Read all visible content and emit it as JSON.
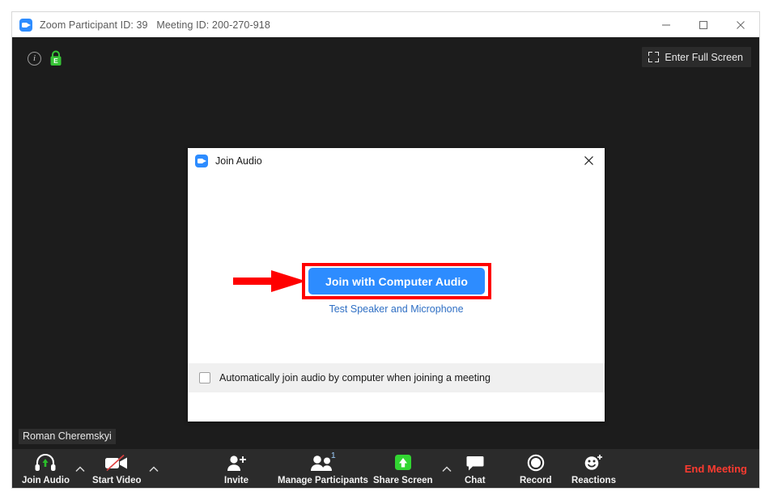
{
  "window": {
    "title": "Zoom Participant ID: 39   Meeting ID: 200-270-918",
    "logo_icon": "zoom-camera-icon",
    "controls": {
      "minimize": "minimize-icon",
      "maximize": "maximize-icon",
      "close": "close-icon"
    }
  },
  "stage": {
    "info_icon": "info-icon",
    "info_glyph": "i",
    "encryption_icon": "green-lock-encrypted-icon",
    "encryption_glyph": "E",
    "full_screen_label": "Enter Full Screen",
    "full_screen_icon": "expand-icon",
    "self_name": "Roman Cheremskyi"
  },
  "dialog": {
    "logo_icon": "zoom-camera-icon",
    "title": "Join Audio",
    "close_icon": "close-icon",
    "primary_button": "Join with Computer Audio",
    "primary_button_color": "#2d8cff",
    "highlight_color": "#ff0000",
    "annotation_arrow": "red-arrow-pointing-right",
    "test_link": "Test Speaker and Microphone",
    "test_link_color": "#2f6fc4",
    "checkbox_checked": false,
    "checkbox_label": "Automatically join audio by computer when joining a meeting"
  },
  "toolbar": {
    "items": [
      {
        "label": "Join Audio",
        "icon": "headset-with-green-up-arrow-icon",
        "caret": true
      },
      {
        "label": "Start Video",
        "icon": "video-camera-slashed-icon",
        "caret": true
      },
      {
        "label": "Invite",
        "icon": "person-add-icon",
        "caret": false
      },
      {
        "label": "Manage Participants",
        "icon": "two-people-icon",
        "caret": false,
        "badge": "1"
      },
      {
        "label": "Share Screen",
        "icon": "green-share-screen-up-arrow-icon",
        "caret": true
      },
      {
        "label": "Chat",
        "icon": "speech-bubble-icon",
        "caret": false
      },
      {
        "label": "Record",
        "icon": "record-circle-icon",
        "caret": false
      },
      {
        "label": "Reactions",
        "icon": "smiley-plus-icon",
        "caret": false
      }
    ],
    "end_meeting_label": "End Meeting",
    "end_meeting_color": "#ff3b30"
  }
}
